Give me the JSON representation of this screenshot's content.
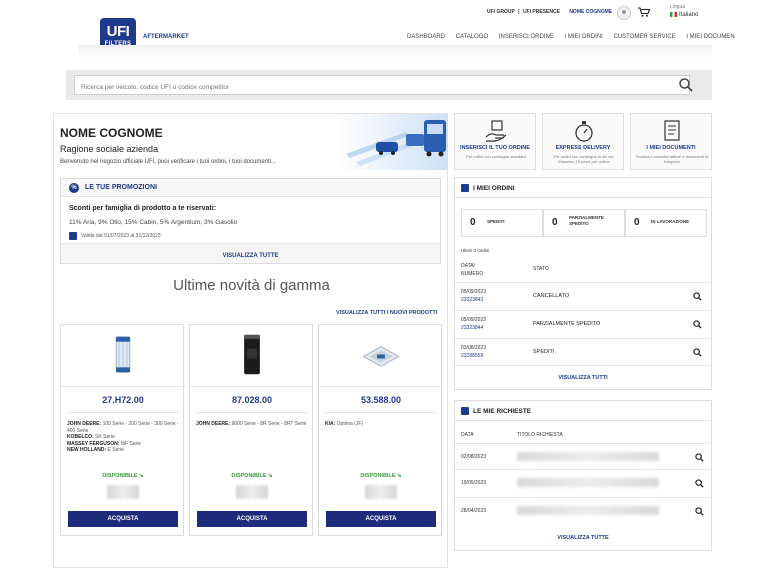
{
  "header": {
    "logo_line1": "UFI",
    "logo_line2": "FILTERS",
    "section": "AFTERMARKET",
    "top_links": [
      "UFI GROUP",
      "|",
      "UFI PRESENCE"
    ],
    "user": "NOME COGNOME",
    "lang_label": "Lingua",
    "lang": "Italiano",
    "nav": [
      "DASHBOARD",
      "CATALOGO",
      "INSERISCI ORDINE",
      "I MIEI ORDINI",
      "CUSTOMER SERVICE",
      "I MIEI DOCUMEN"
    ]
  },
  "search": {
    "placeholder": "Ricerca per veicolo, codice UFI o codice competitor"
  },
  "welcome": {
    "name": "NOME COGNOME",
    "company": "Ragione sociale azienda",
    "text": "Benvenuto nel negozio ufficiale UFI, puoi verificare i tuoi ordini, i tuoi documenti..."
  },
  "promo": {
    "icon": "%",
    "title": "LE TUE PROMOZIONI",
    "subtitle": "Sconti per famiglia di prodotto a te riservati:",
    "text": "11% Aria, 9% Olio, 15% Cabin, 5% Argentium, 3% Gasolio",
    "validity": "Valida dal 01/07/2023 al 31/12/2023",
    "cta": "VISUALIZZA TUTTE"
  },
  "news": {
    "title": "Ultime novità di gamma",
    "all_link": "VISUALIZZA TUTTI I NUOVI PRODOTTI",
    "products": [
      {
        "code": "27.H72.00",
        "apps": [
          [
            "JOHN DEERE:",
            " 100 Serie - 200 Serie - 300 Serie - 400 Serie"
          ],
          [
            "KOBELCO:",
            " SK Serie"
          ],
          [
            "MASSEY FERGUSON:",
            " MF Serie"
          ],
          [
            "NEW HOLLAND:",
            " E Serie"
          ]
        ],
        "avail": "DISPONIBILE",
        "buy": "ACQUISTA"
      },
      {
        "code": "87.028.00",
        "apps": [
          [
            "JOHN DEERE:",
            " 9000 Serie - 8R Serie - 8RT Serie"
          ]
        ],
        "avail": "DISPONIBILE",
        "buy": "ACQUISTA"
      },
      {
        "code": "53.588.00",
        "apps": [
          [
            "KIA:",
            " Optima (JF)"
          ]
        ],
        "avail": "DISPONIBILE",
        "buy": "ACQUISTA"
      }
    ]
  },
  "quick": [
    {
      "title": "INSERISCI IL TUO ORDINE",
      "sub": "Per ordini con consegna standard",
      "icon": "hand-box-icon"
    },
    {
      "title": "EXPRESS DELIVERY",
      "sub": "Per ordini con consegna in 48 ore, Massimo 15 pezzi per ordine",
      "icon": "stopwatch-icon"
    },
    {
      "title": "I MIEI DOCUMENTI",
      "sub": "Scarica o consulta fatture e documenti di trasporto",
      "icon": "document-icon"
    }
  ],
  "orders": {
    "title": "I MIEI ORDINI",
    "stats": [
      {
        "n": "0",
        "label": "SPEDITI"
      },
      {
        "n": "0",
        "label": "PARZIALMENTE SPEDITO"
      },
      {
        "n": "0",
        "label": "IN LAVORAZIONE"
      }
    ],
    "sub": "Ultimi 3 Ordini",
    "col_date": "DATA/",
    "col_num": "NUMERO",
    "col_status": "STATO",
    "rows": [
      {
        "date": "05/09/2023",
        "num": "23323843",
        "status": "CANCELLATO"
      },
      {
        "date": "05/09/2023",
        "num": "23323844",
        "status": "PARZIALMENTE SPEDITO"
      },
      {
        "date": "03/08/2023",
        "num": "23288558",
        "status": "SPEDITI"
      }
    ],
    "cta": "VISUALIZZA TUTTI"
  },
  "requests": {
    "title": "LE MIE RICHIESTE",
    "col_date": "DATA",
    "col_title": "TITOLO RICHIESTA",
    "rows": [
      {
        "date": "02/08/2023"
      },
      {
        "date": "19/05/2023"
      },
      {
        "date": "28/04/2023"
      }
    ],
    "cta": "VISUALIZZA TUTTE"
  },
  "colors": {
    "brand": "#1d3a8c",
    "button": "#1d2b7a",
    "available": "#3a9b3a"
  }
}
